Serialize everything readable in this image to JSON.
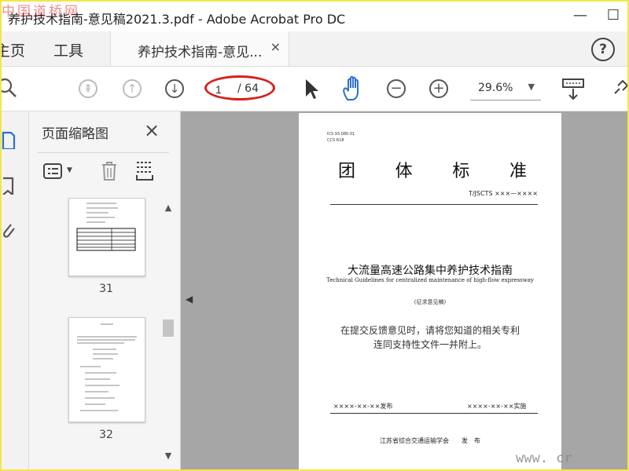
{
  "window": {
    "title": "养护技术指南-意见稿2021.3.pdf - Adobe Acrobat Pro DC",
    "watermark": "中国道桥网",
    "minimize": "—",
    "maximize": "☐"
  },
  "menubar": {
    "home": "主页",
    "tools": "工具",
    "doc_tab": "养护技术指南-意见...",
    "doc_tab_close": "×",
    "help": "?"
  },
  "toolbar": {
    "page_current": "1",
    "page_total": "/ 64",
    "zoom": "29.6%"
  },
  "thumbnails": {
    "title": "页面缩略图",
    "close": "×",
    "pages": [
      "31",
      "32"
    ]
  },
  "document": {
    "ics": "ICS 93.080.01",
    "ccs": "CCS R18",
    "standard_chars": [
      "团",
      "体",
      "标",
      "准"
    ],
    "code": "T/JSCTS ×××—××××",
    "title": "大流量高速公路集中养护技术指南",
    "subtitle": "Technical Guidelines for centralized maintenance of high-flow expressway",
    "draft": "(征求意见稿)",
    "note_line1": "在提交反馈意见时，请将您知道的相关专利",
    "note_line2": "连同支持性文件一并附上。",
    "publish_date": "××××-××-××发布",
    "implement_date": "××××-××-××实施",
    "org": "江苏省综合交通运输学会　　发　布"
  },
  "footer_watermark": "www. cr"
}
